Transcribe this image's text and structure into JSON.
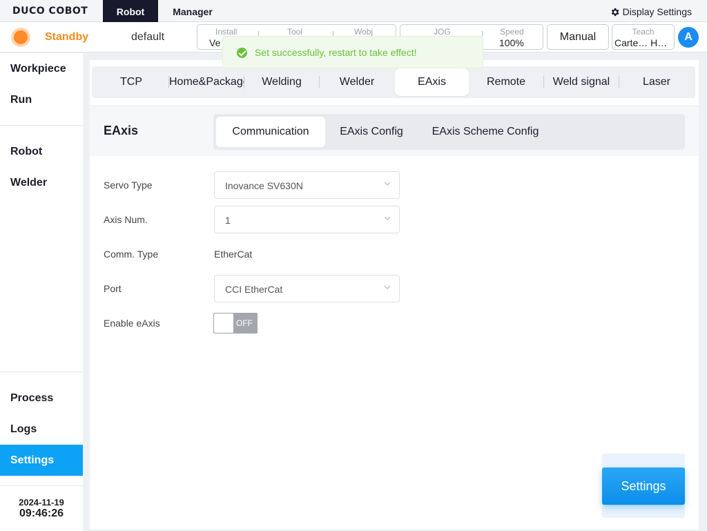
{
  "topbar": {
    "logo": "DUCO COBOT",
    "tabs": [
      "Robot",
      "Manager"
    ],
    "display_settings": "Display Settings"
  },
  "status": {
    "state": "Standby",
    "program": "default",
    "install": {
      "label": "Install",
      "value": "Ve"
    },
    "tool": {
      "label": "Tool",
      "value": ""
    },
    "wobj": {
      "label": "Wobj",
      "value": ""
    },
    "jog": {
      "label": "JOG",
      "value": ""
    },
    "speed": {
      "label": "Speed",
      "value": "100%"
    },
    "mode": "Manual",
    "teach": {
      "label": "Teach",
      "value": "Carte… H…"
    },
    "avatar": "A",
    "state_color": "#f08c1c"
  },
  "toast": {
    "message": "Set successfully, restart to take effect!",
    "color": "#67c23a"
  },
  "sidebar": {
    "items": [
      "Workpiece",
      "Run",
      "Robot",
      "Welder",
      "Process",
      "Logs",
      "Settings"
    ],
    "active": "Settings",
    "date": "2024-11-19",
    "time": "09:46:26",
    "accent": "#0da2f5"
  },
  "main": {
    "tabs": [
      "TCP",
      "Home&Package",
      "Welding",
      "Welder",
      "EAxis",
      "Remote",
      "Weld signal",
      "Laser"
    ],
    "active_tab": "EAxis",
    "section_title": "EAxis",
    "subtabs": [
      "Communication",
      "EAxis Config",
      "EAxis Scheme Config"
    ],
    "active_subtab": "Communication",
    "form": {
      "servo_type": {
        "label": "Servo Type",
        "value": "Inovance SV630N"
      },
      "axis_num": {
        "label": "Axis Num.",
        "value": "1"
      },
      "comm_type": {
        "label": "Comm. Type",
        "value": "EtherCat"
      },
      "port": {
        "label": "Port",
        "value": "CCI EtherCat"
      },
      "enable_eaxis": {
        "label": "Enable eAxis",
        "value": "OFF"
      }
    },
    "float_button": "Settings"
  }
}
